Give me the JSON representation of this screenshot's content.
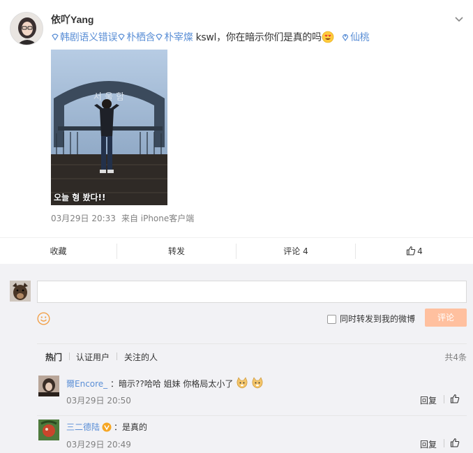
{
  "post": {
    "nickname": "依吖Yang",
    "topics": [
      "韩剧语义错误",
      "朴栖含",
      "朴宰燦"
    ],
    "text": "kswl，你在暗示你们是真的吗",
    "emoji": "heart-eyes-emoji",
    "location": "仙桃",
    "photo_caption": "오늘 형 봤다!!",
    "time": "03月29日 20:33",
    "source": "来自 iPhone客户端"
  },
  "actions": {
    "favorite": "收藏",
    "repost": "转发",
    "comment": "评论 4",
    "like_count": "4"
  },
  "composer": {
    "placeholder": "",
    "repost_label": "同时转发到我的微博",
    "submit": "评论"
  },
  "filters": {
    "hot": "热门",
    "verified": "认证用户",
    "following": "关注的人",
    "total": "共4条"
  },
  "comments": [
    {
      "user": "爾Encore_",
      "text": "：暗示??哈哈 姐妹 你格局太小了",
      "emojis": [
        "doge-emoji",
        "doge-emoji"
      ],
      "time": "03月29日 20:50",
      "reply": "回复"
    },
    {
      "user": "三二德陆",
      "badge": "verified-gold-badge",
      "text": "：是真的",
      "time": "03月29日 20:49",
      "reply": "回复"
    }
  ],
  "colors": {
    "link": "#5b8fd6",
    "submit_bg": "#ffc09f",
    "comment_bg": "#f2f2f5"
  }
}
